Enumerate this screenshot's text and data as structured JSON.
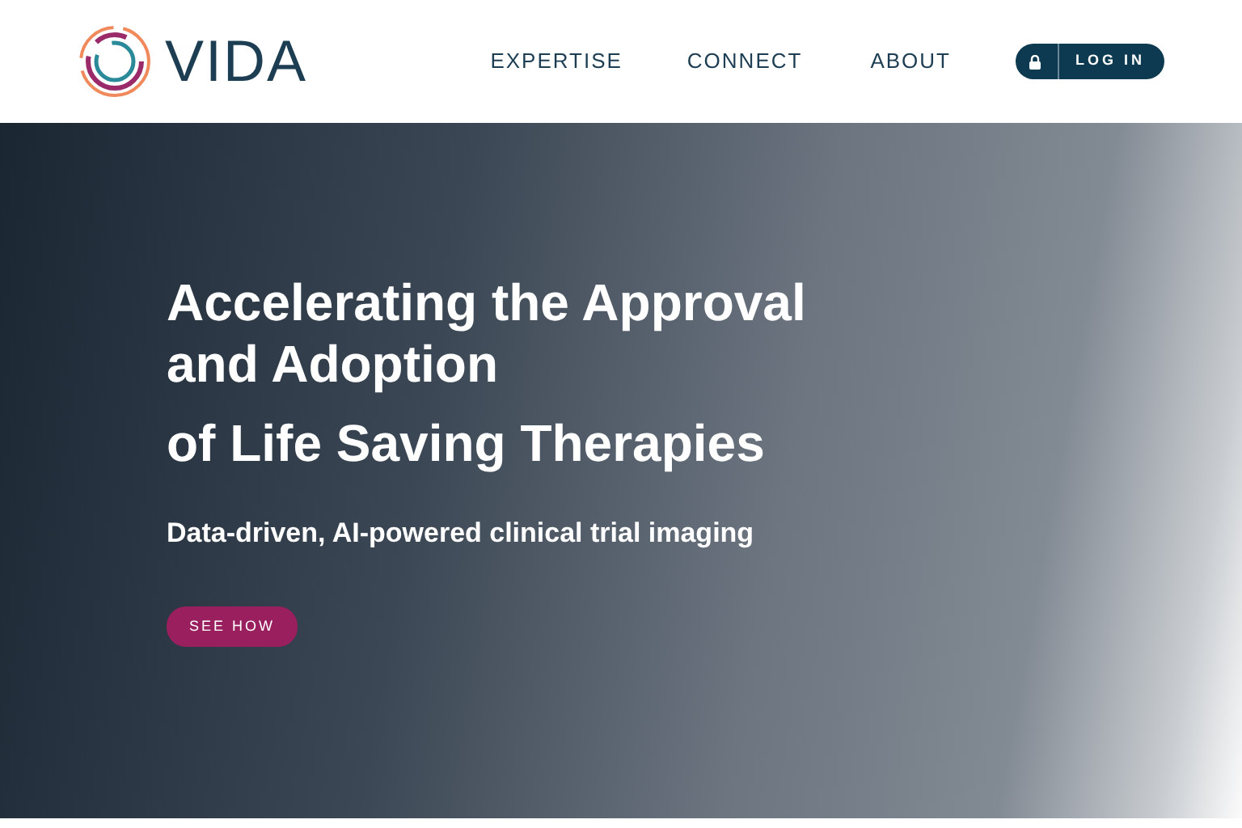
{
  "brand": {
    "name": "VIDA"
  },
  "nav": [
    {
      "label": "EXPERTISE"
    },
    {
      "label": "CONNECT"
    },
    {
      "label": "ABOUT"
    }
  ],
  "login": {
    "label": "LOG IN"
  },
  "hero": {
    "title_lines": [
      "Accelerating the Approval and Adoption",
      "of Life Saving Therapies"
    ],
    "subtitle": "Data-driven, AI-powered clinical trial imaging",
    "button": "SEE HOW"
  }
}
